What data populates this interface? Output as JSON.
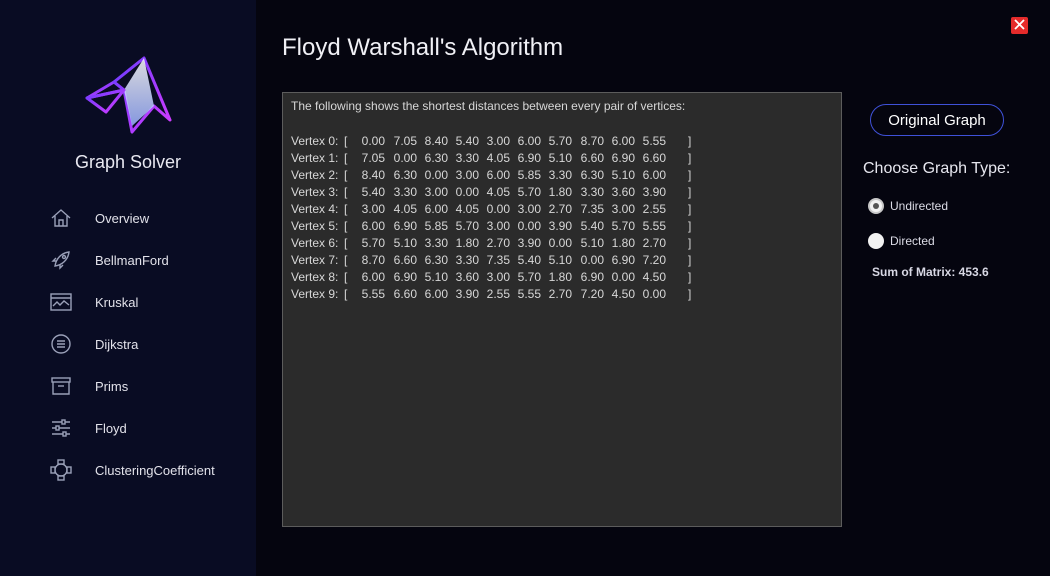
{
  "window": {
    "close_icon": "close-icon"
  },
  "sidebar": {
    "app_title": "Graph Solver",
    "logo_icon": "matlab-membrane-logo",
    "items": [
      {
        "label": "Overview",
        "icon": "home-icon"
      },
      {
        "label": "BellmanFord",
        "icon": "rocket-icon"
      },
      {
        "label": "Kruskal",
        "icon": "chart-window-icon"
      },
      {
        "label": "Dijkstra",
        "icon": "list-circle-icon"
      },
      {
        "label": "Prims",
        "icon": "archive-icon"
      },
      {
        "label": "Floyd",
        "icon": "sliders-icon"
      },
      {
        "label": "ClusteringCoefficient",
        "icon": "cluster-icon"
      }
    ]
  },
  "main": {
    "title": "Floyd Warshall's Algorithm",
    "intro": "The following shows the shortest distances between every pair of vertices:",
    "rows": [
      {
        "label": "Vertex 0:",
        "values": [
          "0.00",
          "7.05",
          "8.40",
          "5.40",
          "3.00",
          "6.00",
          "5.70",
          "8.70",
          "6.00",
          "5.55"
        ]
      },
      {
        "label": "Vertex 1:",
        "values": [
          "7.05",
          "0.00",
          "6.30",
          "3.30",
          "4.05",
          "6.90",
          "5.10",
          "6.60",
          "6.90",
          "6.60"
        ]
      },
      {
        "label": "Vertex 2:",
        "values": [
          "8.40",
          "6.30",
          "0.00",
          "3.00",
          "6.00",
          "5.85",
          "3.30",
          "6.30",
          "5.10",
          "6.00"
        ]
      },
      {
        "label": "Vertex 3:",
        "values": [
          "5.40",
          "3.30",
          "3.00",
          "0.00",
          "4.05",
          "5.70",
          "1.80",
          "3.30",
          "3.60",
          "3.90"
        ]
      },
      {
        "label": "Vertex 4:",
        "values": [
          "3.00",
          "4.05",
          "6.00",
          "4.05",
          "0.00",
          "3.00",
          "2.70",
          "7.35",
          "3.00",
          "2.55"
        ]
      },
      {
        "label": "Vertex 5:",
        "values": [
          "6.00",
          "6.90",
          "5.85",
          "5.70",
          "3.00",
          "0.00",
          "3.90",
          "5.40",
          "5.70",
          "5.55"
        ]
      },
      {
        "label": "Vertex 6:",
        "values": [
          "5.70",
          "5.10",
          "3.30",
          "1.80",
          "2.70",
          "3.90",
          "0.00",
          "5.10",
          "1.80",
          "2.70"
        ]
      },
      {
        "label": "Vertex 7:",
        "values": [
          "8.70",
          "6.60",
          "6.30",
          "3.30",
          "7.35",
          "5.40",
          "5.10",
          "0.00",
          "6.90",
          "7.20"
        ]
      },
      {
        "label": "Vertex 8:",
        "values": [
          "6.00",
          "6.90",
          "5.10",
          "3.60",
          "3.00",
          "5.70",
          "1.80",
          "6.90",
          "0.00",
          "4.50"
        ]
      },
      {
        "label": "Vertex 9:",
        "values": [
          "5.55",
          "6.60",
          "6.00",
          "3.90",
          "2.55",
          "5.55",
          "2.70",
          "7.20",
          "4.50",
          "0.00"
        ]
      }
    ],
    "bracket_open": "[",
    "bracket_close": "]"
  },
  "panel": {
    "original_graph_label": "Original Graph",
    "choose_label": "Choose Graph Type:",
    "options": [
      {
        "label": "Undirected",
        "checked": true
      },
      {
        "label": "Directed",
        "checked": false
      }
    ],
    "sum_label": "Sum of Matrix: 453.6"
  },
  "colors": {
    "sidebar_bg": "#090c23",
    "main_bg": "#05050f",
    "accent": "#3f51d8",
    "close": "#e52b2b",
    "output_bg": "#2b2b2b"
  }
}
